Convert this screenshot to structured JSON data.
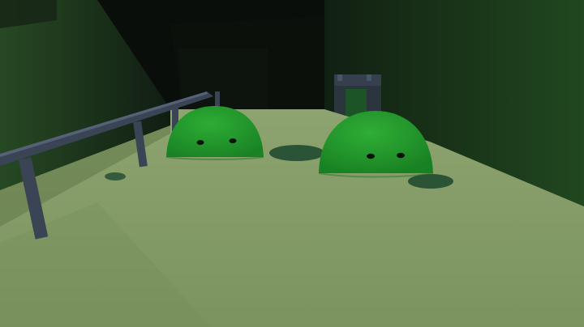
{
  "scene": {
    "colors": {
      "floor": "#8aa26a",
      "floor_near": "#7f9a60",
      "right_wall": "#1f3f1d",
      "left_wall": "#223d1f",
      "ceiling_dark": "#0b110b",
      "back_opening": "#0d120d",
      "railing": "#3f4a5d",
      "railing_highlight": "#5d6a80",
      "slime_green": "#25a72f",
      "slime_dark": "#1a7f24",
      "slime_eye": "#0a140b",
      "puddle": "#2f5b3b"
    },
    "objects": [
      {
        "name": "left-slime",
        "icon": "slime-blob-icon"
      },
      {
        "name": "right-slime",
        "icon": "slime-blob-icon"
      },
      {
        "name": "railing",
        "icon": "metal-railing-icon"
      },
      {
        "name": "doorway",
        "icon": "doorway-icon"
      },
      {
        "name": "green-puddles",
        "icon": "puddle-icon"
      }
    ]
  }
}
